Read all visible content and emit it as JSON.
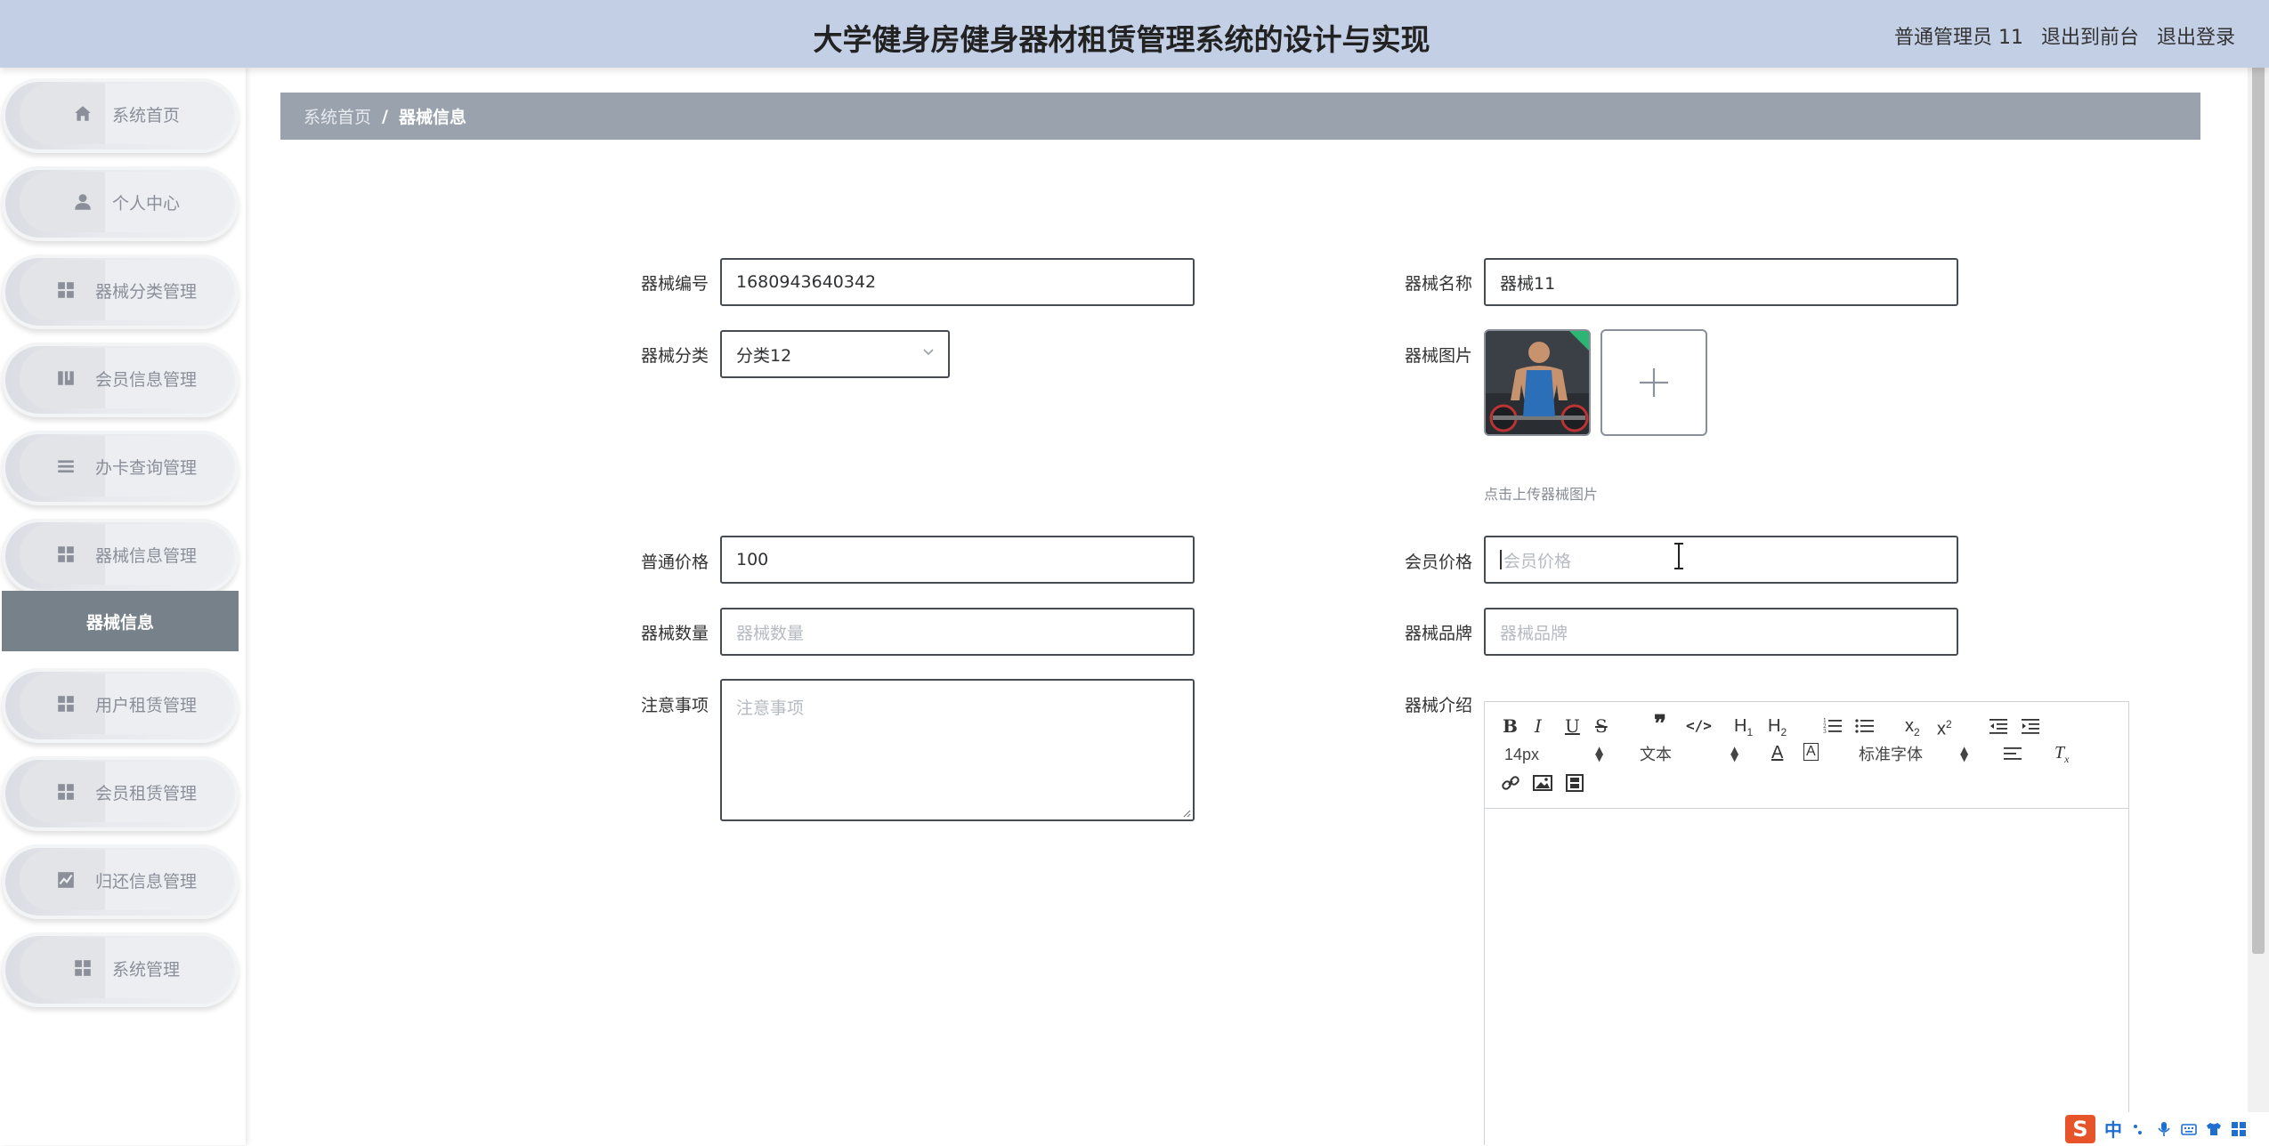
{
  "header": {
    "title": "大学健身房健身器材租赁管理系统的设计与实现",
    "user": "普通管理员 11",
    "to_front": "退出到前台",
    "logout": "退出登录"
  },
  "sidebar": {
    "items": [
      {
        "label": "系统首页",
        "icon": "home-icon"
      },
      {
        "label": "个人中心",
        "icon": "user-icon"
      },
      {
        "label": "器械分类管理",
        "icon": "grid-icon"
      },
      {
        "label": "会员信息管理",
        "icon": "book-icon"
      },
      {
        "label": "办卡查询管理",
        "icon": "list-icon"
      },
      {
        "label": "器械信息管理",
        "icon": "grid-icon"
      },
      {
        "label": "用户租赁管理",
        "icon": "grid-icon"
      },
      {
        "label": "会员租赁管理",
        "icon": "grid-icon"
      },
      {
        "label": "归还信息管理",
        "icon": "chart-icon"
      },
      {
        "label": "系统管理",
        "icon": "grid-icon"
      }
    ],
    "submenu_active": "器械信息"
  },
  "breadcrumb": {
    "home": "系统首页",
    "separator": "/",
    "current": "器械信息"
  },
  "form": {
    "code_label": "器械编号",
    "code_value": "1680943640342",
    "name_label": "器械名称",
    "name_value": "器械11",
    "category_label": "器械分类",
    "category_value": "分类12",
    "image_label": "器械图片",
    "image_hint": "点击上传器械图片",
    "price_label": "普通价格",
    "price_value": "100",
    "member_price_label": "会员价格",
    "member_price_placeholder": "会员价格",
    "quantity_label": "器械数量",
    "quantity_placeholder": "器械数量",
    "brand_label": "器械品牌",
    "brand_placeholder": "器械品牌",
    "notes_label": "注意事项",
    "notes_placeholder": "注意事项",
    "intro_label": "器械介绍"
  },
  "editor": {
    "font_size": "14px",
    "block_type": "文本",
    "font_family": "标准字体"
  },
  "colors": {
    "header_bg": "#c3cfe5",
    "breadcrumb_bg": "#9aa3ad",
    "submenu_bg": "#77818a",
    "ime_brand": "#e8542a"
  }
}
